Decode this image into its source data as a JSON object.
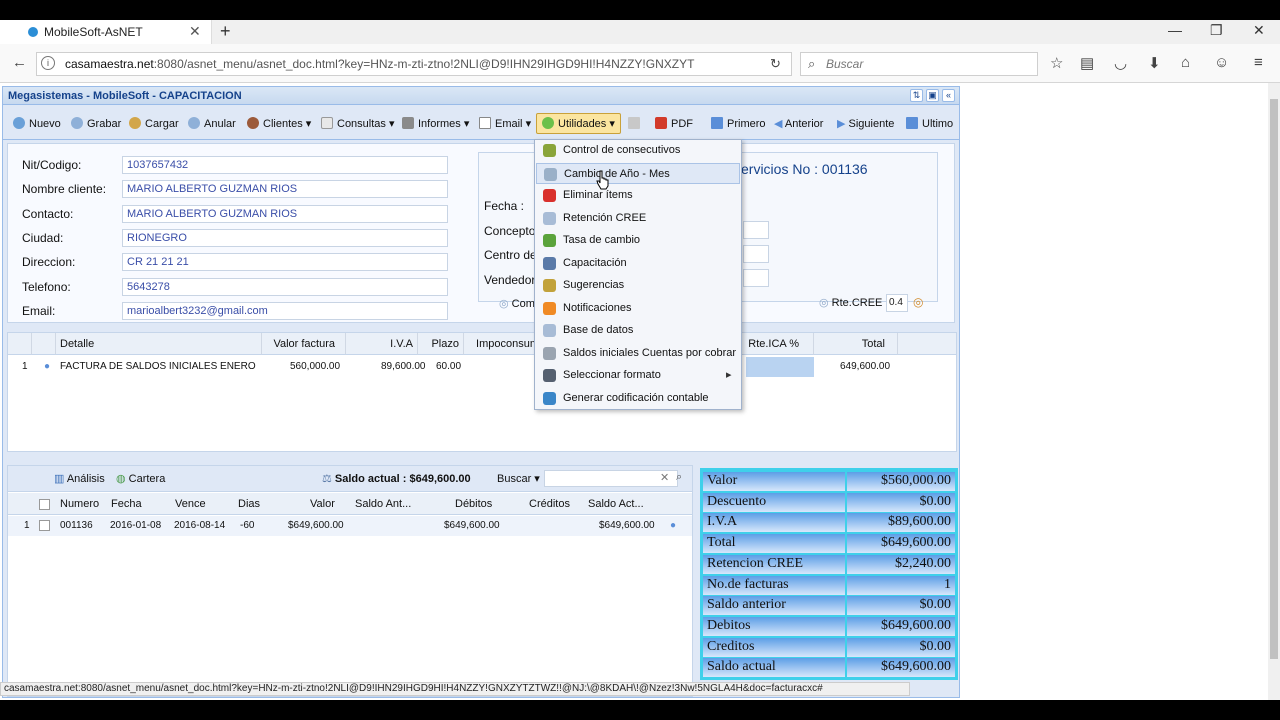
{
  "browser": {
    "tab_title": "MobileSoft-AsNET",
    "url_host": "casamaestra.net",
    "url_rest": ":8080/asnet_menu/asnet_doc.html?key=HNz-m-zti-ztno!2NLI@D9!IHN29IHGD9HI!H4NZZY!GNXZYT",
    "search_placeholder": "Buscar",
    "status_url": "casamaestra.net:8080/asnet_menu/asnet_doc.html?key=HNz-m-zti-ztno!2NLI@D9!IHN29IHGD9HI!H4NZZY!GNXZYTZTWZ!!@NJ:\\@8KDAH\\!@Nzez!3Nw!5NGLA4H&doc=facturacxc#"
  },
  "app": {
    "title": "Megasistemas - MobileSoft - CAPACITACION",
    "toolbar": [
      "Nuevo",
      "Grabar",
      "Cargar",
      "Anular",
      "Clientes",
      "Consultas",
      "Informes",
      "Email",
      "Utilidades",
      "PDF",
      "Primero",
      "Anterior",
      "Siguiente",
      "Ultimo"
    ]
  },
  "form": {
    "labels": {
      "nit": "Nit/Codigo:",
      "nombre": "Nombre cliente:",
      "contacto": "Contacto:",
      "ciudad": "Ciudad:",
      "direccion": "Direccion:",
      "telefono": "Telefono:",
      "email": "Email:"
    },
    "values": {
      "nit": "1037657432",
      "nombre": "MARIO ALBERTO GUZMAN RIOS",
      "contacto": "MARIO ALBERTO GUZMAN RIOS",
      "ciudad": "RIONEGRO",
      "direccion": "CR 21 21 21",
      "telefono": "5643278",
      "email": "marioalbert3232@gmail.com"
    },
    "doc_prefix": "E",
    "doc_number": "ervicios No : 001136",
    "right_labels": {
      "fecha": "Fecha :",
      "concepto": "Concepto:",
      "centro": "Centro de",
      "vendedor": "Vendedor:",
      "comi": "Comi"
    },
    "rte_cree_label": "Rte.CREE",
    "rte_cree_value": "0.4"
  },
  "grid": {
    "headers": [
      "Detalle",
      "Valor factura",
      "I.V.A",
      "Plazo",
      "Impoconsum",
      "Rte.ICA %",
      "Total"
    ],
    "row": {
      "num": "1",
      "detalle": "FACTURA DE SALDOS INICIALES ENERO",
      "valor": "560,000.00",
      "iva": "89,600.00",
      "plazo": "60.00",
      "total": "649,600.00"
    }
  },
  "cartera": {
    "tab_analisis": "Análisis",
    "tab_cartera": "Cartera",
    "saldo_actual": "Saldo actual : $649,600.00",
    "buscar": "Buscar",
    "headers": [
      "Numero",
      "Fecha",
      "Vence",
      "Dias",
      "Valor",
      "Saldo Ant...",
      "Débitos",
      "Créditos",
      "Saldo Act..."
    ],
    "row": {
      "num": "1",
      "numero": "001136",
      "fecha": "2016-01-08",
      "vence": "2016-08-14",
      "dias": "-60",
      "valor": "$649,600.00",
      "debitos": "$649,600.00",
      "saldo_act": "$649,600.00"
    }
  },
  "summary": [
    {
      "label": "Valor",
      "value": "$560,000.00"
    },
    {
      "label": "Descuento",
      "value": "$0.00"
    },
    {
      "label": "I.V.A",
      "value": "$89,600.00"
    },
    {
      "label": "Total",
      "value": "$649,600.00"
    },
    {
      "label": "Retencion CREE",
      "value": "$2,240.00"
    },
    {
      "label": "No.de facturas",
      "value": "1"
    },
    {
      "label": "Saldo anterior",
      "value": "$0.00"
    },
    {
      "label": "Debitos",
      "value": "$649,600.00"
    },
    {
      "label": "Creditos",
      "value": "$0.00"
    },
    {
      "label": "Saldo actual",
      "value": "$649,600.00"
    }
  ],
  "menu": [
    {
      "label": "Control de consecutivos",
      "icon": "pencil-icon",
      "color": "#8aa53a"
    },
    {
      "label": "Cambio de Año - Mes",
      "icon": "calendar-icon",
      "color": "#9ab0c8"
    },
    {
      "label": "Eliminar ítems",
      "icon": "delete-icon",
      "color": "#d9302c"
    },
    {
      "label": "Retención CREE",
      "icon": "percent-icon",
      "color": "#a8bcd6"
    },
    {
      "label": "Tasa de cambio",
      "icon": "dollar-icon",
      "color": "#5ba33b"
    },
    {
      "label": "Capacitación",
      "icon": "monitor-icon",
      "color": "#5a7aa8"
    },
    {
      "label": "Sugerencias",
      "icon": "edit-icon",
      "color": "#c2a23a"
    },
    {
      "label": "Notificaciones",
      "icon": "rss-icon",
      "color": "#f08a24"
    },
    {
      "label": "Base de datos",
      "icon": "database-icon",
      "color": "#a8bcd6"
    },
    {
      "label": "Saldos iniciales Cuentas por cobrar",
      "icon": "coins-icon",
      "color": "#9aa4b0"
    },
    {
      "label": "Seleccionar formato",
      "icon": "printer-icon",
      "color": "#556070"
    },
    {
      "label": "Generar codificación contable",
      "icon": "globe-icon",
      "color": "#3a86c8"
    }
  ]
}
